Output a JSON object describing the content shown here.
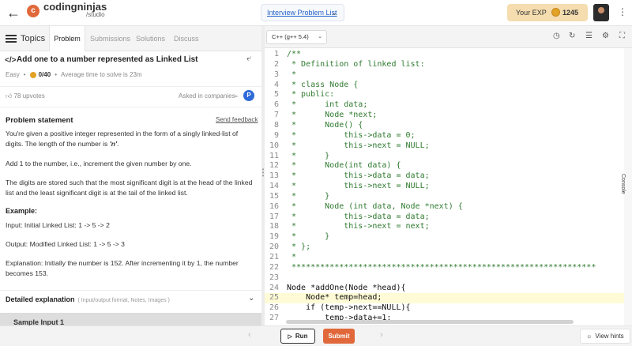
{
  "header": {
    "back_icon": "arrow-left-icon",
    "logo_main": "codingninjas",
    "logo_sub": "/studio",
    "center_dropdown": "Interview Problem List",
    "exp_label": "Your EXP",
    "exp_value": "1245",
    "more_icon": "vertical-dots-icon"
  },
  "tabs": {
    "topics": "Topics",
    "items": [
      "Problem",
      "Submissions",
      "Solutions",
      "Discuss"
    ],
    "active": "Problem"
  },
  "problem": {
    "title": "Add one to a number represented as Linked List",
    "difficulty": "Easy",
    "points": "0/40",
    "avg_time": "Average time to solve is 23m",
    "upvotes": "78 upvotes",
    "asked_in": "Asked in companies",
    "statement_heading": "Problem statement",
    "send_feedback": "Send feedback",
    "statement_pre": "You're given a positive integer represented in the form of a singly linked-list of digits. The length of the number is ",
    "statement_n": "'n'",
    "statement_post": ".",
    "para2": "Add 1 to the number, i.e., increment the given number by one.",
    "para3": "The digits are stored such that the most significant digit is at the head of the linked list and the least significant digit is at the tail of the linked list.",
    "example_heading": "Example:",
    "input": "Input: Initial Linked List: 1 -> 5 -> 2",
    "output": "Output: Modified Linked List: 1 -> 5 -> 3",
    "explanation": "Explanation: Initially the number is 152. After incrementing it by 1, the number becomes 153.",
    "detailed_heading": "Detailed explanation",
    "detailed_sub": "( Input/output format, Notes, Images )",
    "next_section": "Sample Input 1"
  },
  "editor": {
    "language": "C++ (g++ 5.4)",
    "lines": [
      {
        "n": "1",
        "t": "/**"
      },
      {
        "n": "2",
        "t": " * Definition of linked list:"
      },
      {
        "n": "3",
        "t": " *"
      },
      {
        "n": "4",
        "t": " * class Node {"
      },
      {
        "n": "5",
        "t": " * public:"
      },
      {
        "n": "6",
        "t": " *      int data;"
      },
      {
        "n": "7",
        "t": " *      Node *next;"
      },
      {
        "n": "8",
        "t": " *      Node() {"
      },
      {
        "n": "9",
        "t": " *          this->data = 0;"
      },
      {
        "n": "10",
        "t": " *          this->next = NULL;"
      },
      {
        "n": "11",
        "t": " *      }"
      },
      {
        "n": "12",
        "t": " *      Node(int data) {"
      },
      {
        "n": "13",
        "t": " *          this->data = data;"
      },
      {
        "n": "14",
        "t": " *          this->next = NULL;"
      },
      {
        "n": "15",
        "t": " *      }"
      },
      {
        "n": "16",
        "t": " *      Node (int data, Node *next) {"
      },
      {
        "n": "17",
        "t": " *          this->data = data;"
      },
      {
        "n": "18",
        "t": " *          this->next = next;"
      },
      {
        "n": "19",
        "t": " *      }"
      },
      {
        "n": "20",
        "t": " * };"
      },
      {
        "n": "21",
        "t": " *"
      },
      {
        "n": "22",
        "t": " ****************************************************************"
      },
      {
        "n": "23",
        "t": ""
      },
      {
        "n": "24",
        "t": "Node *addOne(Node *head){"
      },
      {
        "n": "25",
        "t": "    Node* temp=head;"
      },
      {
        "n": "26",
        "t": "    if (temp->next==NULL){"
      },
      {
        "n": "27",
        "t": "        temp->data+=1;"
      }
    ],
    "console_label": "Console"
  },
  "footer": {
    "run": "Run",
    "submit": "Submit",
    "view_hints": "View hints"
  },
  "colors": {
    "brand": "#e0683a",
    "link": "#2563c9",
    "comment": "#2f7a2f"
  }
}
